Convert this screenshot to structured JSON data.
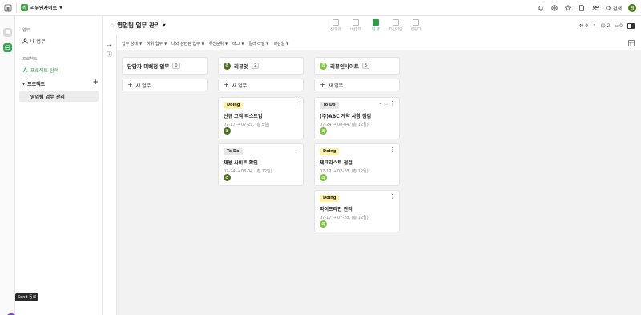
{
  "topbar": {
    "workspace_logo": "리",
    "workspace_name": "리뷰인사이트",
    "search_label": "검색",
    "user_initial": "리",
    "icons": [
      "home-icon",
      "bell-icon",
      "mention-icon",
      "star-icon",
      "document-icon",
      "people-icon",
      "search-icon"
    ]
  },
  "sidebar": {
    "section_work": "업무",
    "my_work": "내 업무",
    "section_project": "프로젝트",
    "project_explore": "프로젝트 탐색",
    "projects_group": "프로젝트",
    "selected_project": "영업팀 업무 관리",
    "help_tooltip": "Send 동료"
  },
  "header": {
    "title": "영업팀 업무 관리",
    "tabs": [
      {
        "label": "상태 뷰",
        "active": false
      },
      {
        "label": "버킷 뷰",
        "active": false
      },
      {
        "label": "팀 뷰",
        "active": true
      },
      {
        "label": "타임라인",
        "active": false
      },
      {
        "label": "캘린더",
        "active": false
      }
    ],
    "stat_tasks": "0",
    "stat_members": "2",
    "stat_folders": "0"
  },
  "filters": [
    "업무 상태",
    "하위 업무",
    "나와 관련된 업무",
    "우선순위",
    "태그",
    "컬러 라벨",
    "마감일"
  ],
  "columns": [
    {
      "title": "담당자 미배정 업무",
      "count": "0",
      "badge": "",
      "badge_color": "",
      "add_label": "새 업무",
      "cards": []
    },
    {
      "title": "리뷰잇",
      "count": "2",
      "badge": "리",
      "badge_color": "#4a6e1e",
      "add_label": "새 업무",
      "cards": [
        {
          "status": "Doing",
          "title": "신규 고객 리스트업",
          "date": "07-17 → 07-21, (총 5일)",
          "assignee": "리",
          "assignee_color": "#4a6e1e"
        },
        {
          "status": "To Do",
          "title": "채용 사이트 확인",
          "date": "07-24 → 08-04, (총 12일)",
          "assignee": "리",
          "assignee_color": "#4a6e1e"
        }
      ]
    },
    {
      "title": "리뷰인사이트",
      "count": "3",
      "badge": "리",
      "badge_color": "#7cc242",
      "add_label": "새 업무",
      "cards": [
        {
          "status": "To Do",
          "title": "(주)ABC 계약 사항 점검",
          "date": "07-24 → 08-04, (총 12일)",
          "assignee": "리",
          "assignee_color": "#7cc242"
        },
        {
          "status": "Doing",
          "title": "체크리스트 점검",
          "date": "07-17 → 07-28, (총 12일)",
          "assignee": "리",
          "assignee_color": "#7cc242"
        },
        {
          "status": "Doing",
          "title": "파이프라인 관리",
          "date": "07-17 → 07-28, (총 12일)",
          "assignee": "리",
          "assignee_color": "#7cc242"
        }
      ]
    }
  ],
  "colors": {
    "accent": "#34a853",
    "doing": "#fff1a8",
    "todo": "#e6e6e6",
    "board_bg": "#f2f2f2"
  }
}
